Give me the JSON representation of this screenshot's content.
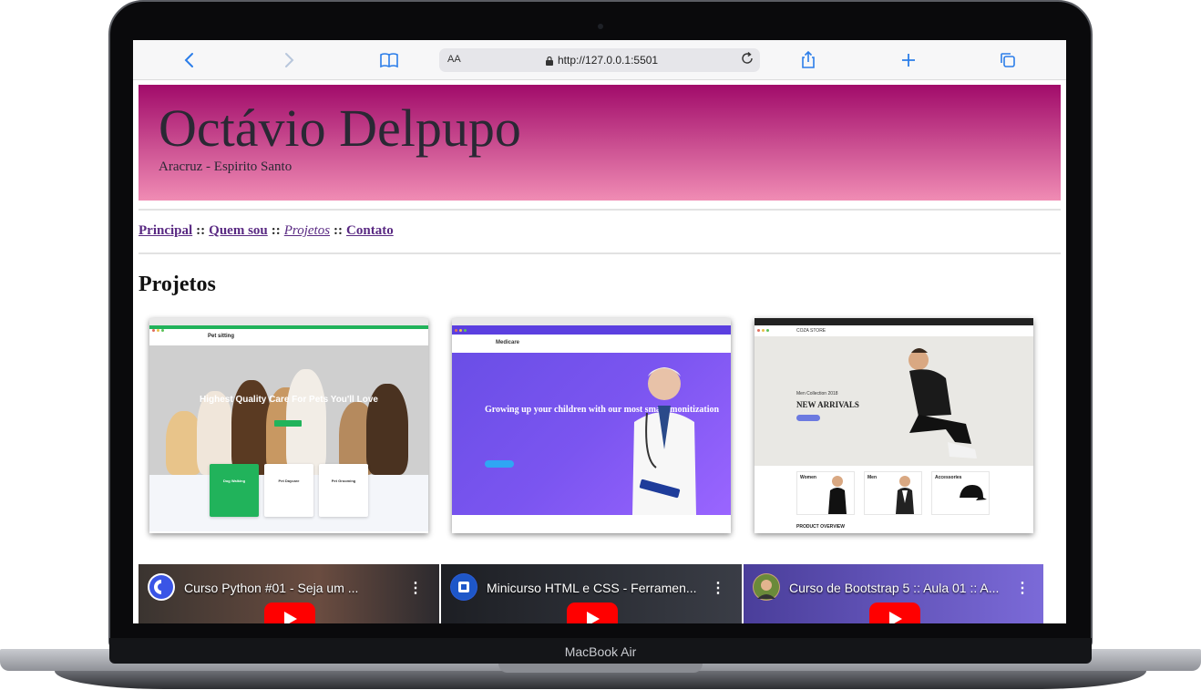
{
  "device": {
    "brand_label": "MacBook Air"
  },
  "browser": {
    "text_size_label": "AA",
    "url": "http://127.0.0.1:5501",
    "icons": [
      "back-icon",
      "forward-icon",
      "bookmarks-icon",
      "lock-icon",
      "reload-icon",
      "share-icon",
      "new-tab-icon",
      "tabs-icon"
    ]
  },
  "header": {
    "name": "Octávio Delpupo",
    "location": "Aracruz - Espirito Santo",
    "gradient": [
      "#a10b6a",
      "#f08cb4"
    ]
  },
  "nav": {
    "items": [
      {
        "label": "Principal"
      },
      {
        "label": "Quem sou"
      },
      {
        "label": "Projetos"
      },
      {
        "label": "Contato"
      }
    ],
    "separator": "::",
    "link_color": "#5a2a83"
  },
  "section": {
    "title": "Projetos"
  },
  "projects": [
    {
      "hero_title": "Highest Quality Care For Pets You'll Love",
      "brand": "Pet sitting",
      "services": [
        "Dog Walking",
        "Pet Daycare",
        "Pet Grooming"
      ]
    },
    {
      "hero_title": "Growing up your children with our most smart monitization",
      "brand": "Medicare"
    },
    {
      "hero_kicker": "Men Collection 2018",
      "hero_title": "NEW ARRIVALS",
      "brand": "COZA STORE",
      "categories": [
        "Women",
        "Men",
        "Accessories"
      ],
      "footer": "PRODUCT OVERVIEW"
    }
  ],
  "videos": [
    {
      "title": "Curso Python #01 - Seja um ..."
    },
    {
      "title": "Minicurso HTML e CSS - Ferramen..."
    },
    {
      "title": "Curso de Bootstrap 5 :: Aula 01 :: A..."
    }
  ]
}
